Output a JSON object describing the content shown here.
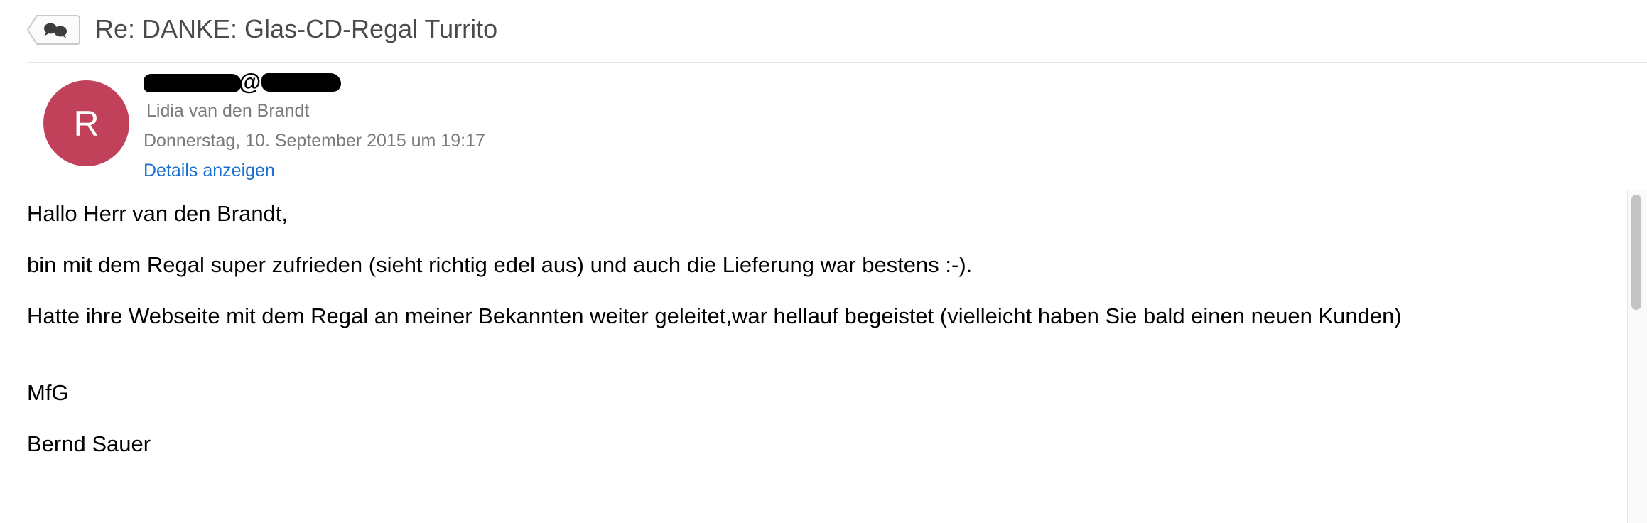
{
  "header": {
    "subject": "Re: DANKE: Glas-CD-Regal Turrito"
  },
  "message": {
    "avatar_initial": "R",
    "sender_at": "@",
    "to_name": "Lidia van den Brandt",
    "date": "Donnerstag, 10. September 2015 um 19:17",
    "details_link": "Details anzeigen",
    "avatar_color": "#c1405a",
    "link_color": "#1a6fd0"
  },
  "body": {
    "lines": [
      "Hallo Herr van den Brandt,",
      "bin mit dem Regal super zufrieden (sieht richtig edel aus) und auch die Lieferung war bestens :-).",
      "Hatte ihre Webseite mit dem Regal an meiner Bekannten weiter geleitet,war hellauf begeistet (vielleicht haben Sie bald einen neuen Kunden)",
      "MfG",
      "Bernd Sauer"
    ]
  },
  "icons": {
    "back": "reply-conversation-icon"
  }
}
